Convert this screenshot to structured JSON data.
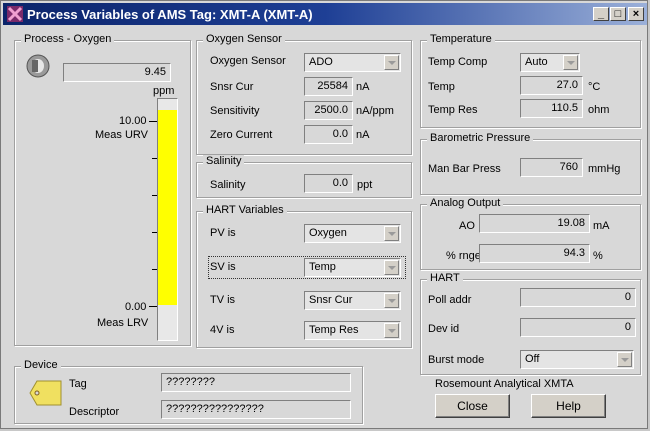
{
  "window": {
    "title": "Process Variables of AMS Tag:  XMT-A (XMT-A)"
  },
  "titlebar_buttons": {
    "minimize": "_",
    "maximize": "□",
    "close": "×"
  },
  "process": {
    "group_label": "Process - Oxygen",
    "value": "9.45",
    "unit": "ppm",
    "urv_value": "10.00",
    "urv_label": "Meas URV",
    "lrv_value": "0.00",
    "lrv_label": "Meas LRV",
    "bar_fill_fraction": 0.945,
    "bar_color": "#ffff00"
  },
  "oxygen_sensor": {
    "group_label": "Oxygen Sensor",
    "sensor_label": "Oxygen Sensor",
    "sensor_value": "ADO",
    "snsr_cur_label": "Snsr Cur",
    "snsr_cur_value": "25584",
    "snsr_cur_unit": "nA",
    "sensitivity_label": "Sensitivity",
    "sensitivity_value": "2500.0",
    "sensitivity_unit": "nA/ppm",
    "zero_label": "Zero Current",
    "zero_value": "0.0",
    "zero_unit": "nA"
  },
  "salinity": {
    "group_label": "Salinity",
    "label": "Salinity",
    "value": "0.0",
    "unit": "ppt"
  },
  "hart_vars": {
    "group_label": "HART Variables",
    "pv_label": "PV is",
    "pv_value": "Oxygen",
    "sv_label": "SV is",
    "sv_value": "Temp",
    "tv_label": "TV is",
    "tv_value": "Snsr Cur",
    "qv_label": "4V is",
    "qv_value": "Temp Res"
  },
  "temperature": {
    "group_label": "Temperature",
    "comp_label": "Temp Comp",
    "comp_value": "Auto",
    "temp_label": "Temp",
    "temp_value": "27.0",
    "temp_unit": "°C",
    "res_label": "Temp Res",
    "res_value": "110.5",
    "res_unit": "ohm"
  },
  "barometric": {
    "group_label": "Barometric Pressure",
    "label": "Man Bar Press",
    "value": "760",
    "unit": "mmHg"
  },
  "analog_output": {
    "group_label": "Analog Output",
    "ao_label": "AO",
    "ao_value": "19.08",
    "ao_unit": "mA",
    "range_label": "% rnge",
    "range_value": "94.3",
    "range_unit": "%"
  },
  "hart": {
    "group_label": "HART",
    "poll_label": "Poll addr",
    "poll_value": "0",
    "dev_label": "Dev id",
    "dev_value": "0",
    "burst_label": "Burst mode",
    "burst_value": "Off"
  },
  "device": {
    "group_label": "Device",
    "tag_label": "Tag",
    "tag_value": "????????",
    "desc_label": "Descriptor",
    "desc_value": "????????????????"
  },
  "footer": {
    "product": "Rosemount Analytical XMTA",
    "close_label": "Close",
    "help_label": "Help"
  }
}
